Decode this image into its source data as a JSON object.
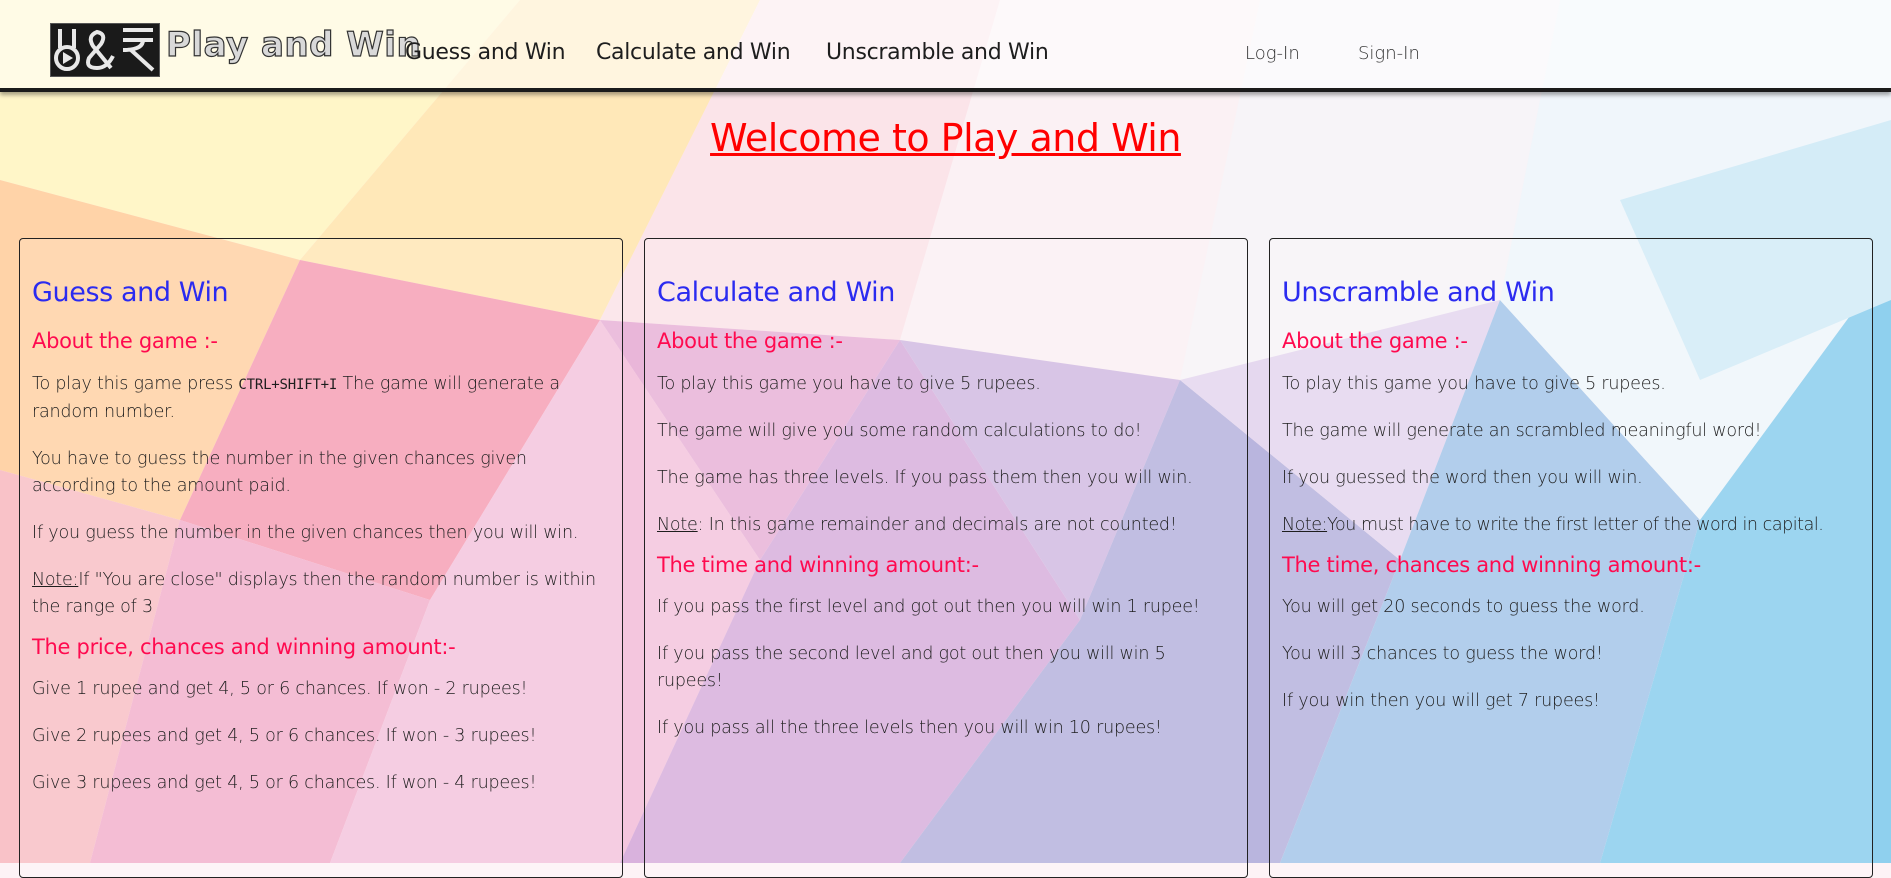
{
  "header": {
    "logo_text": "Play and Win",
    "nav": [
      "Guess and Win",
      "Calculate and Win",
      "Unscramble and Win"
    ],
    "login": "Log-In",
    "signin": "Sign-In"
  },
  "page_title": "Welcome to Play and Win",
  "cards": [
    {
      "title": "Guess and Win",
      "about_heading": "About the game :-",
      "p1_before": "To play this game press ",
      "p1_kbd": "CTRL+SHIFT+I",
      "p1_after": " The game will generate a random number.",
      "p2": "You have to guess the number in the given chances given according to the amount paid.",
      "p3": "If you guess the number in the given chances then you will win.",
      "note_label": "Note:",
      "note_text": "If \"You are close\" displays then the random number is within the range of 3",
      "second_heading": "The price, chances and winning amount:-",
      "items": [
        "Give 1 rupee and get 4, 5 or 6 chances. If won - 2 rupees!",
        "Give 2 rupees and get 4, 5 or 6 chances. If won - 3 rupees!",
        "Give 3 rupees and get 4, 5 or 6 chances. If won - 4 rupees!"
      ]
    },
    {
      "title": "Calculate and Win",
      "about_heading": "About the game :-",
      "p1": "To play this game you have to give 5 rupees.",
      "p2": "The game will give you some random calculations to do!",
      "p3": "The game has three levels. If you pass them then you will win.",
      "note_label": "Note",
      "note_text": ": In this game remainder and decimals are not counted!",
      "second_heading": "The time and winning amount:-",
      "items": [
        "If you pass the first level and got out then you will win 1 rupee!",
        "If you pass the second level and got out then you will win 5 rupees!",
        "If you pass all the three levels then you will win 10 rupees!"
      ]
    },
    {
      "title": "Unscramble and Win",
      "about_heading": "About the game :-",
      "p1": "To play this game you have to give 5 rupees.",
      "p2": "The game will generate an scrambled meaningful word!",
      "p3": "If you guessed the word then you will win.",
      "note_label": "Note:",
      "note_text": "You must have to write the first letter of the word in capital.",
      "second_heading": "The time, chances and winning amount:-",
      "items": [
        "You will get 20 seconds to guess the word.",
        "You will 3 chances to guess the word!",
        "If you win then you will get 7 rupees!"
      ]
    }
  ]
}
